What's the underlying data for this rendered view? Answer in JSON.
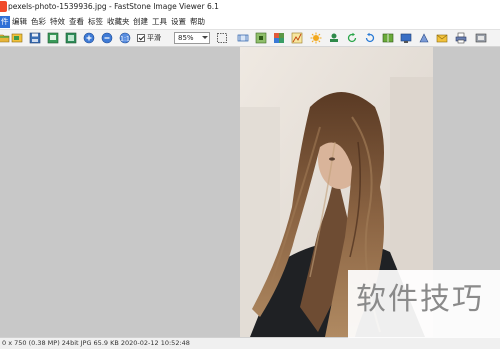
{
  "window": {
    "title": "pexels-photo-1539936.jpg  -  FastStone Image Viewer 6.1"
  },
  "menu": {
    "items": [
      {
        "label": "件"
      },
      {
        "label": "编辑"
      },
      {
        "label": "色彩"
      },
      {
        "label": "特效"
      },
      {
        "label": "查看"
      },
      {
        "label": "标签"
      },
      {
        "label": "收藏夹"
      },
      {
        "label": "创建"
      },
      {
        "label": "工具"
      },
      {
        "label": "设置"
      },
      {
        "label": "帮助"
      }
    ]
  },
  "toolbar": {
    "smooth_label": "平滑",
    "smooth_checked": true,
    "zoom_value": "85%",
    "icons": [
      "open-folder-icon",
      "browse-icon",
      "save-icon",
      "save-as-icon",
      "slideshow-icon",
      "zoom-in-icon",
      "zoom-out-icon",
      "actual-size-icon",
      "select-icon",
      "crop-icon",
      "resize-icon",
      "color-icon",
      "brightness-icon",
      "stamp-icon",
      "rotate-left-icon",
      "rotate-right-icon",
      "flip-icon",
      "wallpaper-icon",
      "compare-icon",
      "email-icon",
      "print-icon",
      "settings-icon"
    ]
  },
  "status": {
    "text": "0 x 750 (0.38 MP)  24bit  JPG   65.9 KB   2020-02-12 10:52:48"
  },
  "watermark": {
    "text": "软件技巧"
  },
  "colors": {
    "menu_active": "#2f6fd6",
    "viewer_bg": "#c8c8c8",
    "toolbar_bg": "#f3f3f3"
  }
}
